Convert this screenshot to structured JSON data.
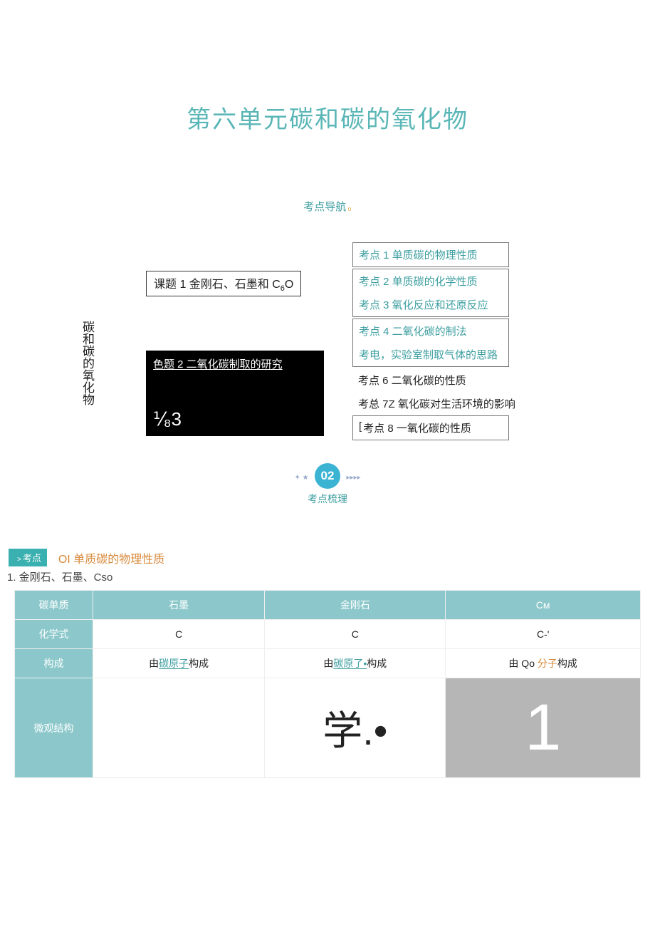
{
  "title": "第六单元碳和碳的氧化物",
  "nav_heading": "考点导航",
  "diagram": {
    "vlabel": "碳和碳的氧化物",
    "topic1_prefix": "课题 1 金刚石、石墨和 C",
    "topic1_sub": "6",
    "topic1_suffix": "O",
    "black_title": "色题 2 二氧化碳制取的研究",
    "black_frac": "⅟₈3",
    "kp1": "考点 1 单质碳的物理性质",
    "kp2": "考点 2 单质碳的化学性质",
    "kp3": "考点 3 氧化反应和还原反应",
    "kp4": "考点 4 二氧化碳的制法",
    "kp5": "考电，实验室制取气体的思路",
    "kp6": "考点 6 二氧化碳的性质",
    "kp7": "考总 7Z 氧化碳对生活环境的影响",
    "kp8": "考点 8 一氧化碳的性质",
    "bracket": "["
  },
  "section2": {
    "num": "02",
    "label": "考点梳理"
  },
  "topic": {
    "tag_arrow": ">",
    "tag": "考点",
    "title": "OI 单质碳的物理性质",
    "sub": "1. 金刚石、石墨、Cso"
  },
  "table": {
    "head": [
      "碳单质",
      "石墨",
      "金刚石",
      "Cᴍ"
    ],
    "row_formula": {
      "label": "化学式",
      "c1": "C",
      "c2": "C",
      "c3": "C-'"
    },
    "row_build": {
      "label": "构成",
      "c1_a": "由",
      "c1_link": "碳原子",
      "c1_b": "构成",
      "c2_a": "由",
      "c2_link": "碳原了•",
      "c2_b": "构成",
      "c3_a": "由 Qo ",
      "c3_org": "分子",
      "c3_b": "构成"
    },
    "row_struct": {
      "label": "微观结构",
      "c2_txt": "学.•",
      "c3_txt": "1"
    }
  }
}
